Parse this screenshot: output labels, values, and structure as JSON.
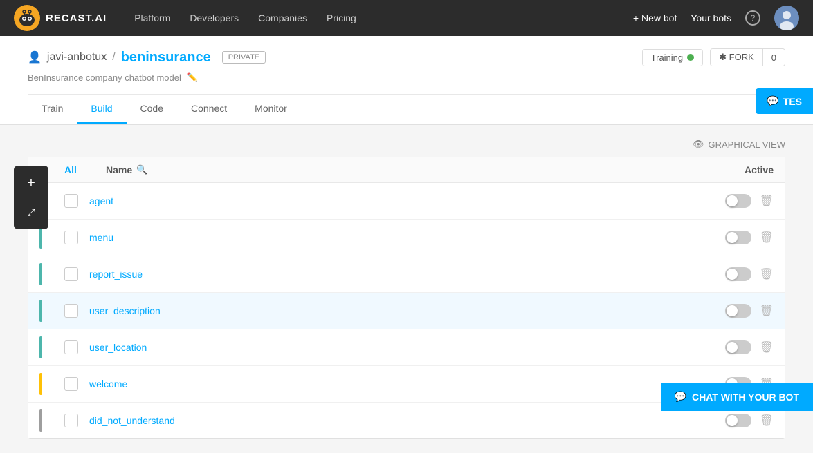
{
  "nav": {
    "logo_text": "RECAST.AI",
    "links": [
      "Platform",
      "Developers",
      "Companies",
      "Pricing"
    ],
    "new_bot_label": "+ New bot",
    "your_bots_label": "Your bots",
    "help_label": "?"
  },
  "header": {
    "user": "javi-anbotux",
    "separator": "/",
    "bot": "beninsurance",
    "private_label": "PRIVATE",
    "description": "BenInsurance company chatbot model",
    "training_label": "Training",
    "fork_label": "✱ FORK",
    "fork_count": "0"
  },
  "tabs": {
    "items": [
      "Train",
      "Build",
      "Code",
      "Connect",
      "Monitor"
    ],
    "active": "Build"
  },
  "toolbar": {
    "graphical_view_label": "GRAPHICAL VIEW",
    "add_label": "+",
    "expand_label": "⤢"
  },
  "table": {
    "col_all": "All",
    "col_name": "Name",
    "col_active": "Active",
    "intents": [
      {
        "name": "agent",
        "color": "#4db6ac",
        "highlighted": false
      },
      {
        "name": "menu",
        "color": "#4db6ac",
        "highlighted": false
      },
      {
        "name": "report_issue",
        "color": "#4db6ac",
        "highlighted": false
      },
      {
        "name": "user_description",
        "color": "#4db6ac",
        "highlighted": true
      },
      {
        "name": "user_location",
        "color": "#4db6ac",
        "highlighted": false
      },
      {
        "name": "welcome",
        "color": "#ffc107",
        "highlighted": false
      },
      {
        "name": "did_not_understand",
        "color": "#9e9e9e",
        "highlighted": false
      }
    ]
  },
  "test_btn_label": "TES",
  "chat_btn_label": "CHAT WITH YOUR BOT"
}
